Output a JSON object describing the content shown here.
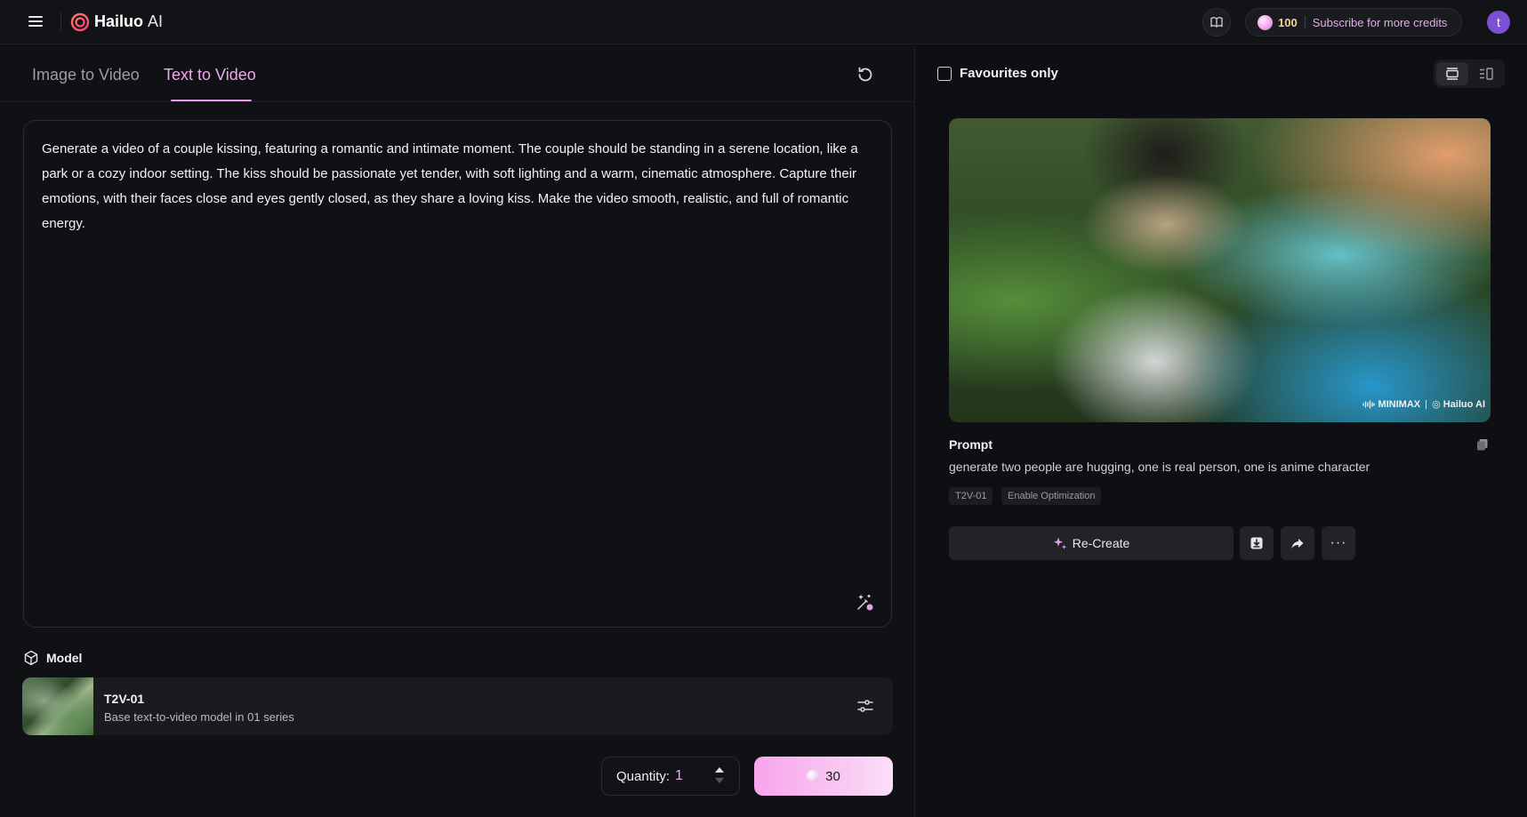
{
  "header": {
    "brand_name": "Hailuo",
    "brand_suffix": "AI",
    "credits": "100",
    "subscribe_label": "Subscribe for more credits",
    "avatar_initial": "t"
  },
  "tabs": [
    {
      "label": "Image to Video",
      "active": false
    },
    {
      "label": "Text to Video",
      "active": true
    }
  ],
  "prompt": {
    "text": "Generate a video of a couple kissing, featuring a romantic and intimate moment. The couple should be standing in a serene location, like a park or a cozy indoor setting. The kiss should be passionate yet tender, with soft lighting and a warm, cinematic atmosphere. Capture their emotions, with their faces close and eyes gently closed, as they share a loving kiss. Make the video smooth, realistic, and full of romantic energy."
  },
  "model": {
    "section_label": "Model",
    "name": "T2V-01",
    "description": "Base text-to-video model in 01 series"
  },
  "quantity": {
    "label": "Quantity:",
    "value": "1"
  },
  "generate": {
    "cost": "30"
  },
  "right": {
    "favourites_label": "Favourites only",
    "watermark_left": "MINIMAX",
    "watermark_right": "Hailuo AI",
    "prompt_heading": "Prompt",
    "prompt_text": "generate two people are hugging, one is real person, one is anime character",
    "tags": [
      "T2V-01",
      "Enable Optimization"
    ],
    "recreate_label": "Re-Create",
    "more_label": "···"
  },
  "colors": {
    "accent": "#f0a6ef",
    "credit_gold": "#f4d58c",
    "avatar": "#7b4fd6",
    "background": "#0e0f12"
  }
}
